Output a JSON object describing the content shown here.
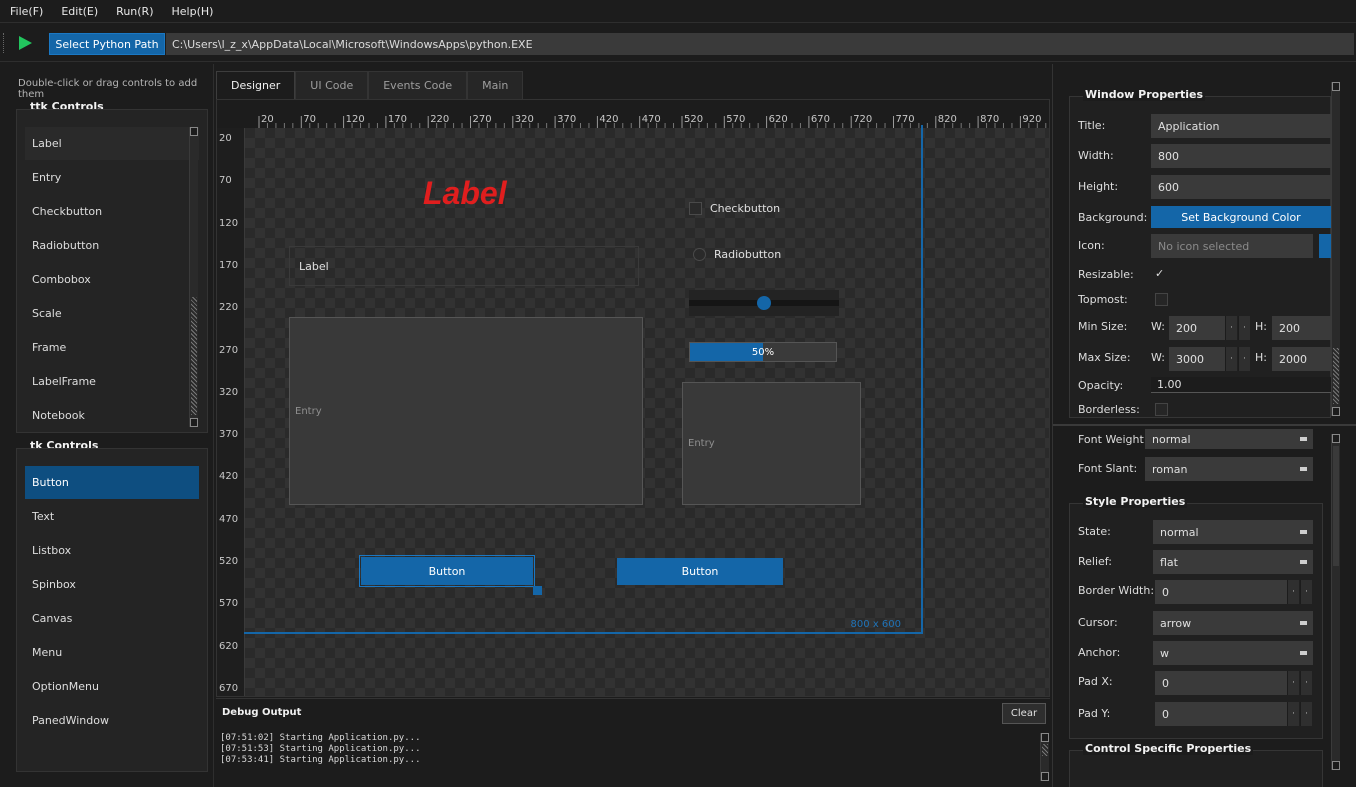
{
  "menubar": [
    "File(F)",
    "Edit(E)",
    "Run(R)",
    "Help(H)"
  ],
  "toolbar": {
    "select_path_label": "Select Python Path",
    "python_path": "C:\\Users\\l_z_x\\AppData\\Local\\Microsoft\\WindowsApps\\python.EXE"
  },
  "left": {
    "hint": "Double-click or drag controls to add them",
    "ttk_title": "ttk Controls",
    "ttk_items": [
      "Label",
      "Entry",
      "Checkbutton",
      "Radiobutton",
      "Combobox",
      "Scale",
      "Frame",
      "LabelFrame",
      "Notebook"
    ],
    "tk_title": "tk Controls",
    "tk_items": [
      "Button",
      "Text",
      "Listbox",
      "Spinbox",
      "Canvas",
      "Menu",
      "OptionMenu",
      "PanedWindow"
    ]
  },
  "tabs": [
    "Designer",
    "UI Code",
    "Events Code",
    "Main"
  ],
  "ruler": {
    "top": [
      "20",
      "70",
      "120",
      "170",
      "220",
      "270",
      "320",
      "370",
      "420",
      "470",
      "520",
      "570",
      "620",
      "670",
      "720",
      "770",
      "820",
      "870",
      "920"
    ],
    "left": [
      "20",
      "70",
      "120",
      "170",
      "220",
      "270",
      "320",
      "370",
      "420",
      "470",
      "520",
      "570",
      "620",
      "670"
    ]
  },
  "canvas": {
    "big_label": "Label",
    "label2": "Label",
    "entry1": "Entry",
    "entry2": "Entry",
    "checkbutton": "Checkbutton",
    "radiobutton": "Radiobutton",
    "progress_text": "50%",
    "progress_value": 0.5,
    "scale_value": 0.5,
    "button1": "Button",
    "button2": "Button",
    "size_badge": "800 x 600",
    "label_color": "#e01e1e",
    "accent_color": "#1466a8"
  },
  "debug": {
    "title": "Debug Output",
    "clear_label": "Clear",
    "lines": [
      "[07:51:02] Starting Application.py...",
      "[07:51:53] Starting Application.py...",
      "[07:53:41] Starting Application.py..."
    ]
  },
  "window_props": {
    "title": "Window Properties",
    "title_label": "Title:",
    "title_value": "Application",
    "width_label": "Width:",
    "width_value": "800",
    "height_label": "Height:",
    "height_value": "600",
    "background_label": "Background:",
    "background_button": "Set Background Color",
    "icon_label": "Icon:",
    "icon_placeholder": "No icon selected",
    "resizable_label": "Resizable:",
    "resizable_mark": "✓",
    "topmost_label": "Topmost:",
    "minsize_label": "Min Size:",
    "min_w": "200",
    "min_h": "200",
    "maxsize_label": "Max Size:",
    "max_w": "3000",
    "max_h": "2000",
    "w_label": "W:",
    "h_label": "H:",
    "opacity_label": "Opacity:",
    "opacity_value": "1.00",
    "borderless_label": "Borderless:"
  },
  "font_props": {
    "weight_label": "Font Weight:",
    "weight_value": "normal",
    "slant_label": "Font Slant:",
    "slant_value": "roman"
  },
  "style_props": {
    "title": "Style Properties",
    "state_label": "State:",
    "state_value": "normal",
    "relief_label": "Relief:",
    "relief_value": "flat",
    "border_label": "Border Width:",
    "border_value": "0",
    "cursor_label": "Cursor:",
    "cursor_value": "arrow",
    "anchor_label": "Anchor:",
    "anchor_value": "w",
    "padx_label": "Pad X:",
    "padx_value": "0",
    "pady_label": "Pad Y:",
    "pady_value": "0"
  },
  "control_props": {
    "title": "Control Specific Properties"
  }
}
